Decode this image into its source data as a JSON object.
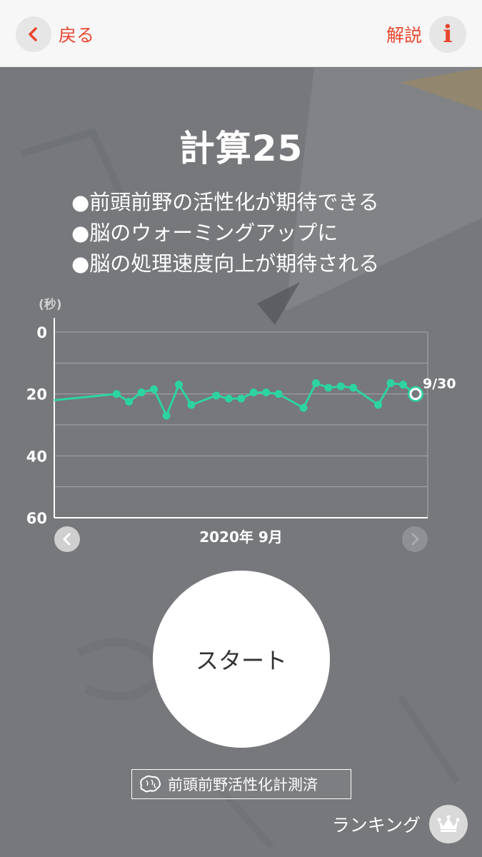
{
  "header": {
    "back_label": "戻る",
    "help_label": "解説",
    "help_icon_glyph": "i",
    "accent_color": "#e8462f"
  },
  "title": "計算25",
  "bullets": [
    "●前頭前野の活性化が期待できる",
    "●脳のウォーミングアップに",
    "●脳の処理速度向上が期待される"
  ],
  "chart_data": {
    "type": "line",
    "ylabel": "(秒)",
    "ylim": [
      0,
      60
    ],
    "y_inverted": true,
    "y_ticks": [
      "0",
      "20",
      "40",
      "60"
    ],
    "xlabel": "2020年 9月",
    "x_days_in_month": 30,
    "line_color": "#2dd3a0",
    "grid": true,
    "points": [
      {
        "x": 1,
        "y": 22
      },
      {
        "x": 6,
        "y": 20
      },
      {
        "x": 7,
        "y": 22.5
      },
      {
        "x": 8,
        "y": 19.5
      },
      {
        "x": 9,
        "y": 18.5
      },
      {
        "x": 10,
        "y": 27
      },
      {
        "x": 11,
        "y": 17
      },
      {
        "x": 12,
        "y": 23.5
      },
      {
        "x": 14,
        "y": 20.5
      },
      {
        "x": 15,
        "y": 21.5
      },
      {
        "x": 16,
        "y": 21.5
      },
      {
        "x": 17,
        "y": 19.5
      },
      {
        "x": 18,
        "y": 19.5
      },
      {
        "x": 19,
        "y": 20
      },
      {
        "x": 21,
        "y": 24.5
      },
      {
        "x": 22,
        "y": 16.5
      },
      {
        "x": 23,
        "y": 18
      },
      {
        "x": 24,
        "y": 17.5
      },
      {
        "x": 25,
        "y": 18
      },
      {
        "x": 27,
        "y": 23.5
      },
      {
        "x": 28,
        "y": 16.5
      },
      {
        "x": 29,
        "y": 17
      },
      {
        "x": 30,
        "y": 20
      }
    ],
    "latest_label": "9/30"
  },
  "start_label": "スタート",
  "badge_label": "前頭前野活性化計測済",
  "ranking_label": "ランキング"
}
